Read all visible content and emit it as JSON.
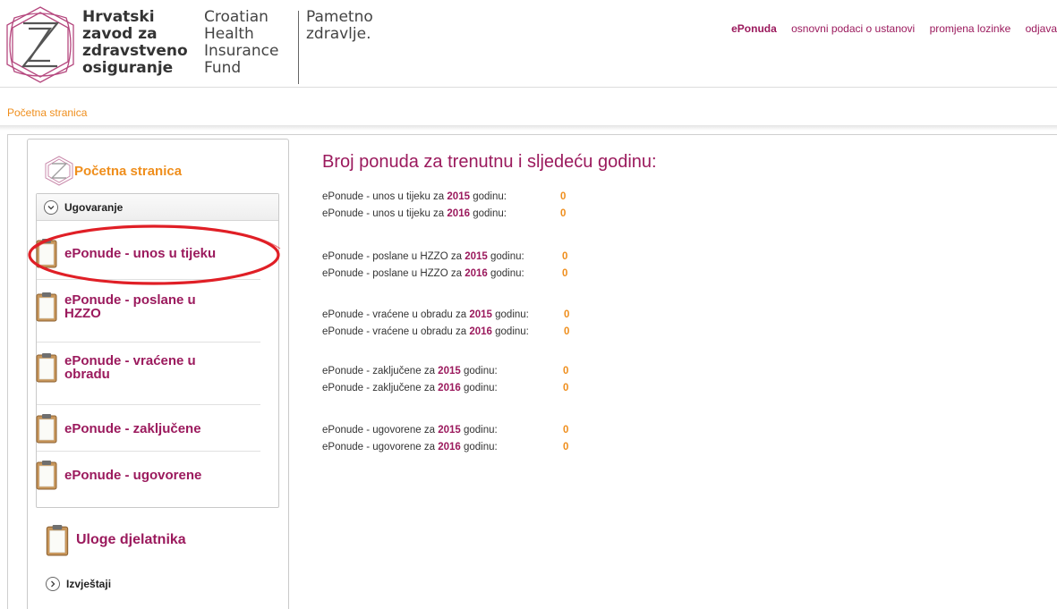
{
  "brand": {
    "hr_lines": [
      "Hrvatski",
      "zavod za",
      "zdravstveno",
      "osiguranje"
    ],
    "en_lines": [
      "Croatian",
      "Health",
      "Insurance",
      "Fund"
    ],
    "pz_lines": [
      "Pametno",
      "zdravlje."
    ]
  },
  "topnav": [
    {
      "label": "ePonuda",
      "active": true
    },
    {
      "label": "osnovni podaci o ustanovi",
      "active": false
    },
    {
      "label": "promjena lozinke",
      "active": false
    },
    {
      "label": "odjava",
      "active": false
    }
  ],
  "breadcrumb": "Početna stranica",
  "sidebar": {
    "home_label": "Početna stranica",
    "group_label": "Ugovaranje",
    "items": [
      {
        "label": "ePonude - unos u tijeku"
      },
      {
        "label": "ePonude - poslane u HZZO"
      },
      {
        "label": "ePonude - vraćene u obradu"
      },
      {
        "label": "ePonude - zaključene"
      },
      {
        "label": "ePonude - ugovorene"
      }
    ],
    "staff_label": "Uloge djelatnika",
    "reports_label": "Izvještaji"
  },
  "main": {
    "title": "Broj ponuda za trenutnu i sljedeću godinu:",
    "year_word": "godinu:",
    "za_word": "za",
    "groups": [
      {
        "prefix": "ePonude - unos u tijeku",
        "rows": [
          {
            "year": "2015",
            "count": "0"
          },
          {
            "year": "2016",
            "count": "0"
          }
        ]
      },
      {
        "prefix": "ePonude - poslane u HZZO",
        "rows": [
          {
            "year": "2015",
            "count": "0"
          },
          {
            "year": "2016",
            "count": "0"
          }
        ]
      },
      {
        "prefix": "ePonude - vraćene u obradu",
        "rows": [
          {
            "year": "2015",
            "count": "0"
          },
          {
            "year": "2016",
            "count": "0"
          }
        ]
      },
      {
        "prefix": "ePonude - zaključene",
        "rows": [
          {
            "year": "2015",
            "count": "0"
          },
          {
            "year": "2016",
            "count": "0"
          }
        ]
      },
      {
        "prefix": "ePonude - ugovorene",
        "rows": [
          {
            "year": "2015",
            "count": "0"
          },
          {
            "year": "2016",
            "count": "0"
          }
        ]
      }
    ]
  },
  "colors": {
    "brand_magenta": "#9b1a5d",
    "accent_orange": "#ef8e1c",
    "highlight_red": "#e01f26"
  }
}
